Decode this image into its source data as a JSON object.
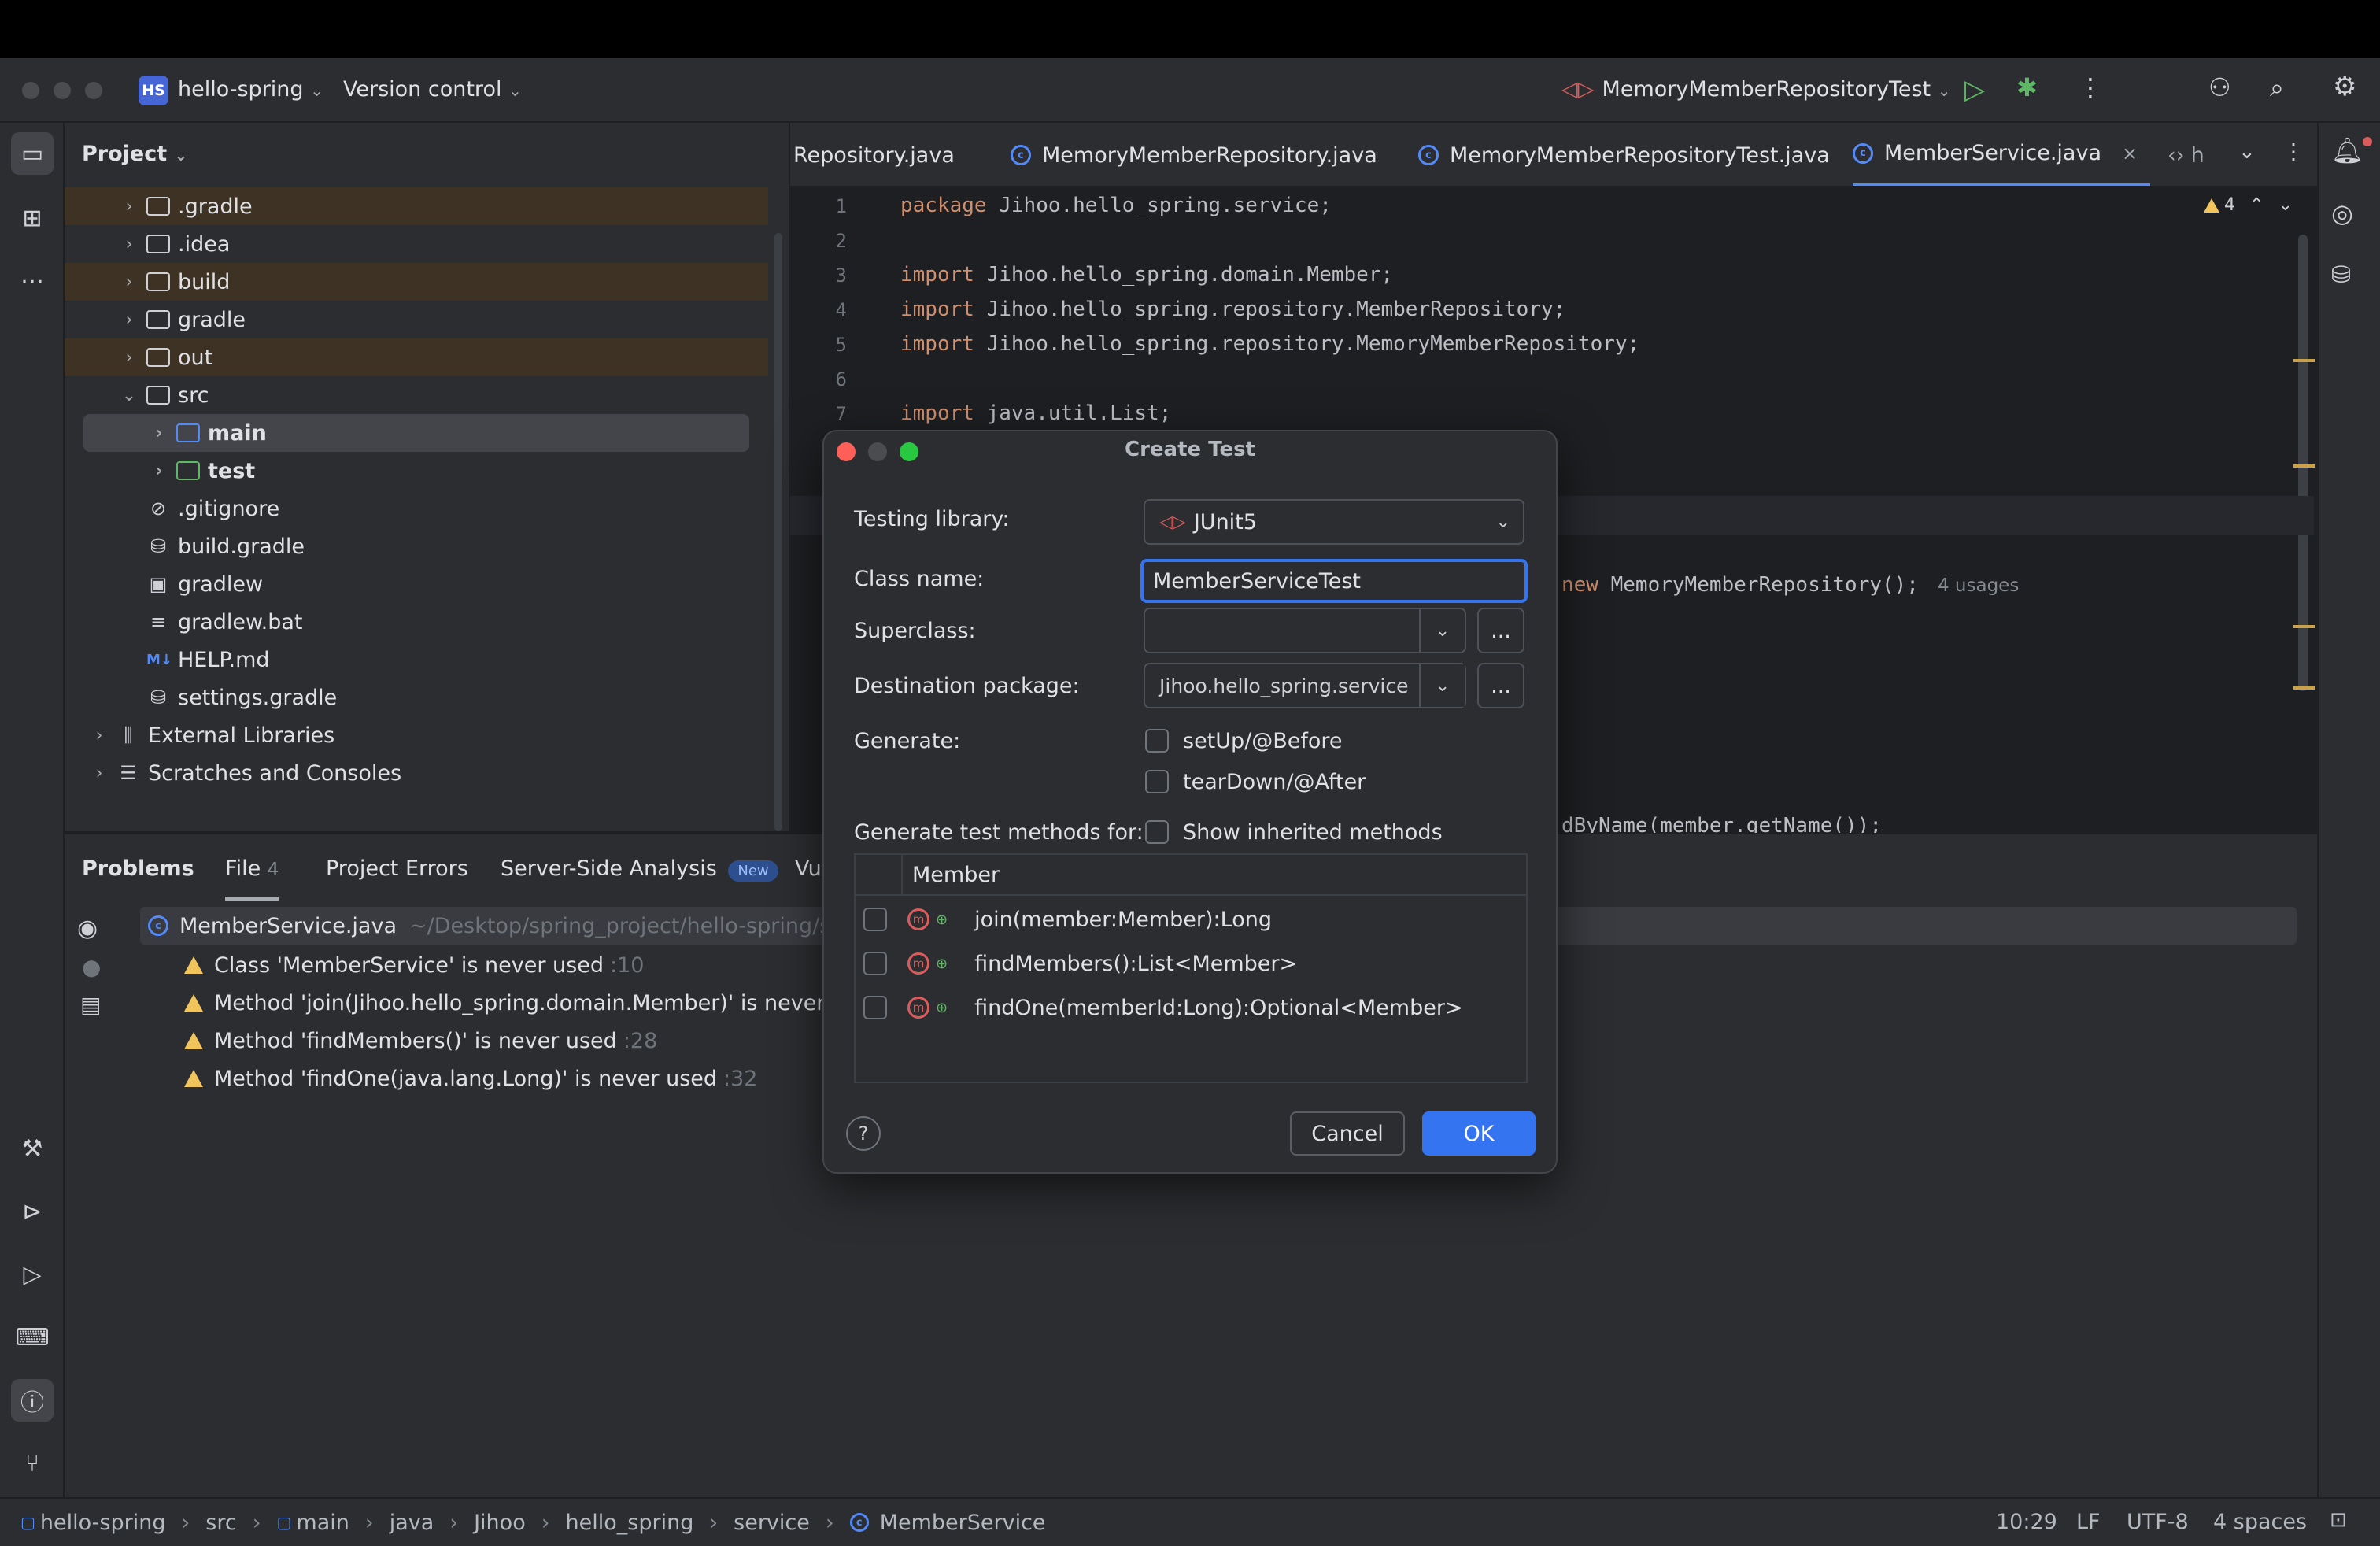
{
  "titlebar": {
    "project_badge": "HS",
    "project_name": "hello-spring",
    "vcs_label": "Version control",
    "run_config": "MemoryMemberRepositoryTest"
  },
  "project_panel": {
    "title": "Project",
    "tree": [
      {
        "label": ".gradle"
      },
      {
        "label": ".idea"
      },
      {
        "label": "build"
      },
      {
        "label": "gradle"
      },
      {
        "label": "out"
      },
      {
        "label": "src"
      },
      {
        "label": "main"
      },
      {
        "label": "test"
      },
      {
        "label": ".gitignore"
      },
      {
        "label": "build.gradle"
      },
      {
        "label": "gradlew"
      },
      {
        "label": "gradlew.bat"
      },
      {
        "label": "HELP.md"
      },
      {
        "label": "settings.gradle"
      },
      {
        "label": "External Libraries"
      },
      {
        "label": "Scratches and Consoles"
      }
    ]
  },
  "editor_tabs": [
    {
      "label": "Repository.java"
    },
    {
      "label": "MemoryMemberRepository.java"
    },
    {
      "label": "MemoryMemberRepositoryTest.java"
    },
    {
      "label": "MemberService.java"
    },
    {
      "label": "h"
    }
  ],
  "editor": {
    "warning_count": "4",
    "lines": [
      {
        "n": "1",
        "kw": "package",
        "rest": " Jihoo.hello_spring.service;"
      },
      {
        "n": "2",
        "kw": "",
        "rest": ""
      },
      {
        "n": "3",
        "kw": "import",
        "rest": " Jihoo.hello_spring.domain.Member;"
      },
      {
        "n": "4",
        "kw": "import",
        "rest": " Jihoo.hello_spring.repository.MemberRepository;"
      },
      {
        "n": "5",
        "kw": "import",
        "rest": " Jihoo.hello_spring.repository.MemoryMemberRepository;"
      },
      {
        "n": "6",
        "kw": "",
        "rest": ""
      },
      {
        "n": "7",
        "kw": "import",
        "rest": " java.util.List;"
      }
    ],
    "partial_line_kw": "new",
    "partial_line_code": " MemoryMemberRepository();",
    "partial_usages": "4 usages",
    "partial_line2": "dByName(member.getName());"
  },
  "problems": {
    "tabs": [
      {
        "label": "Problems"
      },
      {
        "label": "File",
        "count": "4"
      },
      {
        "label": "Project Errors"
      },
      {
        "label": "Server-Side Analysis",
        "badge": "New"
      },
      {
        "label": "Vu"
      }
    ],
    "file_name": "MemberService.java",
    "file_path": "~/Desktop/spring_project/hello-spring/src/ma",
    "items": [
      {
        "text": "Class 'MemberService' is never used",
        "line": ":10"
      },
      {
        "text": "Method 'join(Jihoo.hello_spring.domain.Member)' is never used",
        "line": ""
      },
      {
        "text": "Method 'findMembers()' is never used",
        "line": ":28"
      },
      {
        "text": "Method 'findOne(java.lang.Long)' is never used",
        "line": ":32"
      }
    ]
  },
  "dialog": {
    "title": "Create Test",
    "testing_library_label": "Testing library:",
    "testing_library_value": "JUnit5",
    "class_name_label": "Class name:",
    "class_name_value": "MemberServiceTest",
    "superclass_label": "Superclass:",
    "superclass_value": "",
    "dest_package_label": "Destination package:",
    "dest_package_value": "Jihoo.hello_spring.service",
    "browse_label": "...",
    "generate_label": "Generate:",
    "setup_label": "setUp/@Before",
    "teardown_label": "tearDown/@After",
    "methods_for_label": "Generate test methods for:",
    "show_inherited_label": "Show inherited methods",
    "member_header": "Member",
    "members": [
      {
        "label": "join(member:Member):Long"
      },
      {
        "label": "findMembers():List<Member>"
      },
      {
        "label": "findOne(memberId:Long):Optional<Member>"
      }
    ],
    "help_label": "?",
    "cancel_label": "Cancel",
    "ok_label": "OK"
  },
  "statusbar": {
    "breadcrumb": [
      "hello-spring",
      "src",
      "main",
      "java",
      "Jihoo",
      "hello_spring",
      "service",
      "MemberService"
    ],
    "caret": "10:29",
    "line_sep": "LF",
    "encoding": "UTF-8",
    "indent": "4 spaces"
  },
  "colors": {
    "accent": "#3574f0",
    "warning": "#f2c55c",
    "keyword": "#cf8e6d",
    "excluded_folder_bg": "#3d3223"
  }
}
